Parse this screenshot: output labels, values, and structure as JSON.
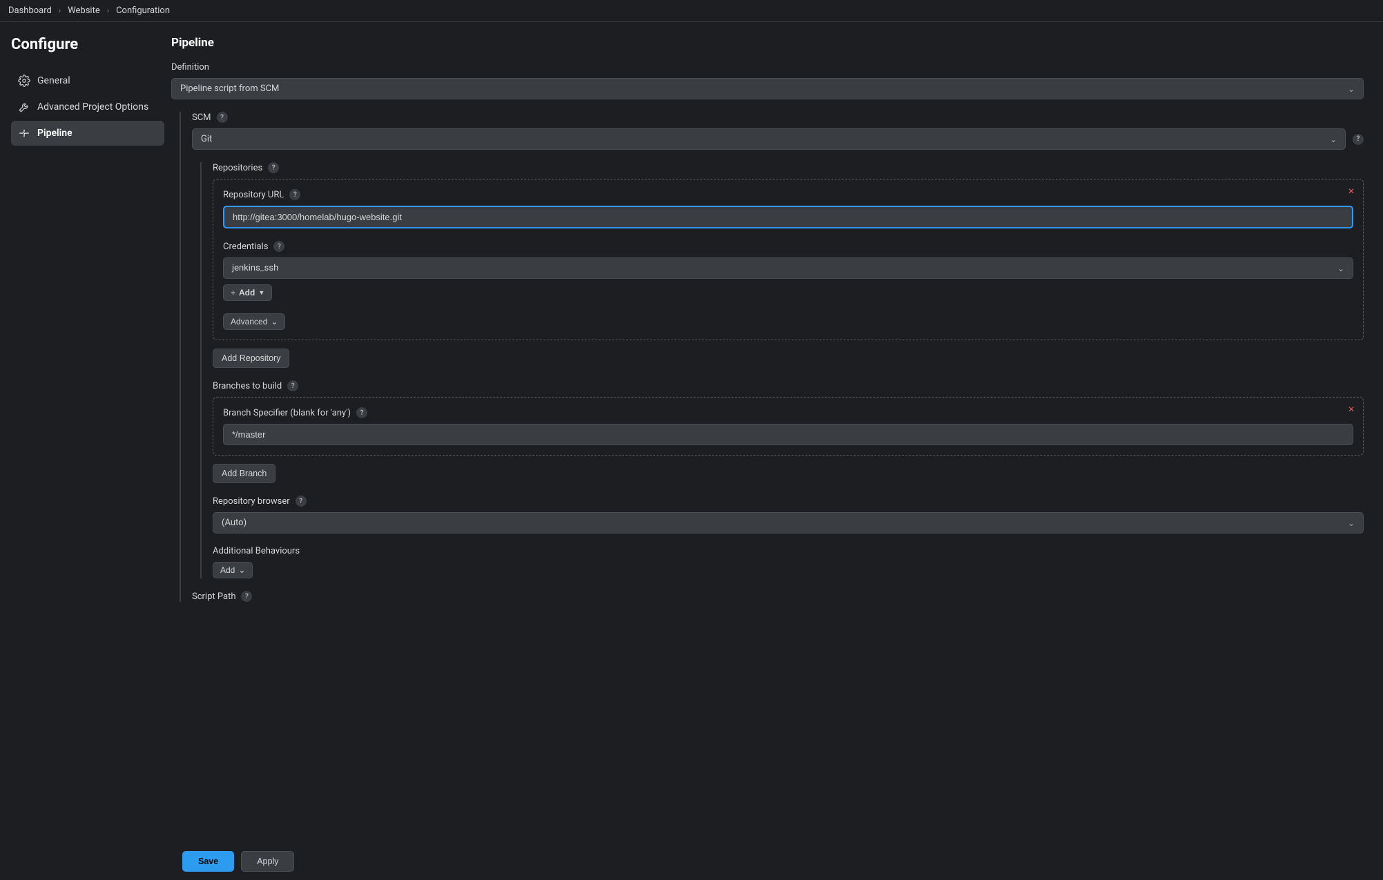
{
  "breadcrumb": {
    "items": [
      "Dashboard",
      "Website",
      "Configuration"
    ]
  },
  "sidebar": {
    "title": "Configure",
    "items": [
      {
        "label": "General"
      },
      {
        "label": "Advanced Project Options"
      },
      {
        "label": "Pipeline"
      }
    ]
  },
  "main": {
    "title": "Pipeline",
    "definition_label": "Definition",
    "definition_value": "Pipeline script from SCM",
    "scm_label": "SCM",
    "scm_value": "Git",
    "repositories": {
      "label": "Repositories",
      "repo_url_label": "Repository URL",
      "repo_url_value": "http://gitea:3000/homelab/hugo-website.git",
      "credentials_label": "Credentials",
      "credentials_value": "jenkins_ssh",
      "add_cred_label": "Add",
      "advanced_label": "Advanced",
      "add_repo_label": "Add Repository"
    },
    "branches": {
      "label": "Branches to build",
      "spec_label": "Branch Specifier (blank for 'any')",
      "spec_value": "*/master",
      "add_branch_label": "Add Branch"
    },
    "repo_browser": {
      "label": "Repository browser",
      "value": "(Auto)"
    },
    "behaviours": {
      "label": "Additional Behaviours",
      "add_label": "Add"
    },
    "script_path": {
      "label": "Script Path"
    }
  },
  "footer": {
    "save": "Save",
    "apply": "Apply"
  }
}
